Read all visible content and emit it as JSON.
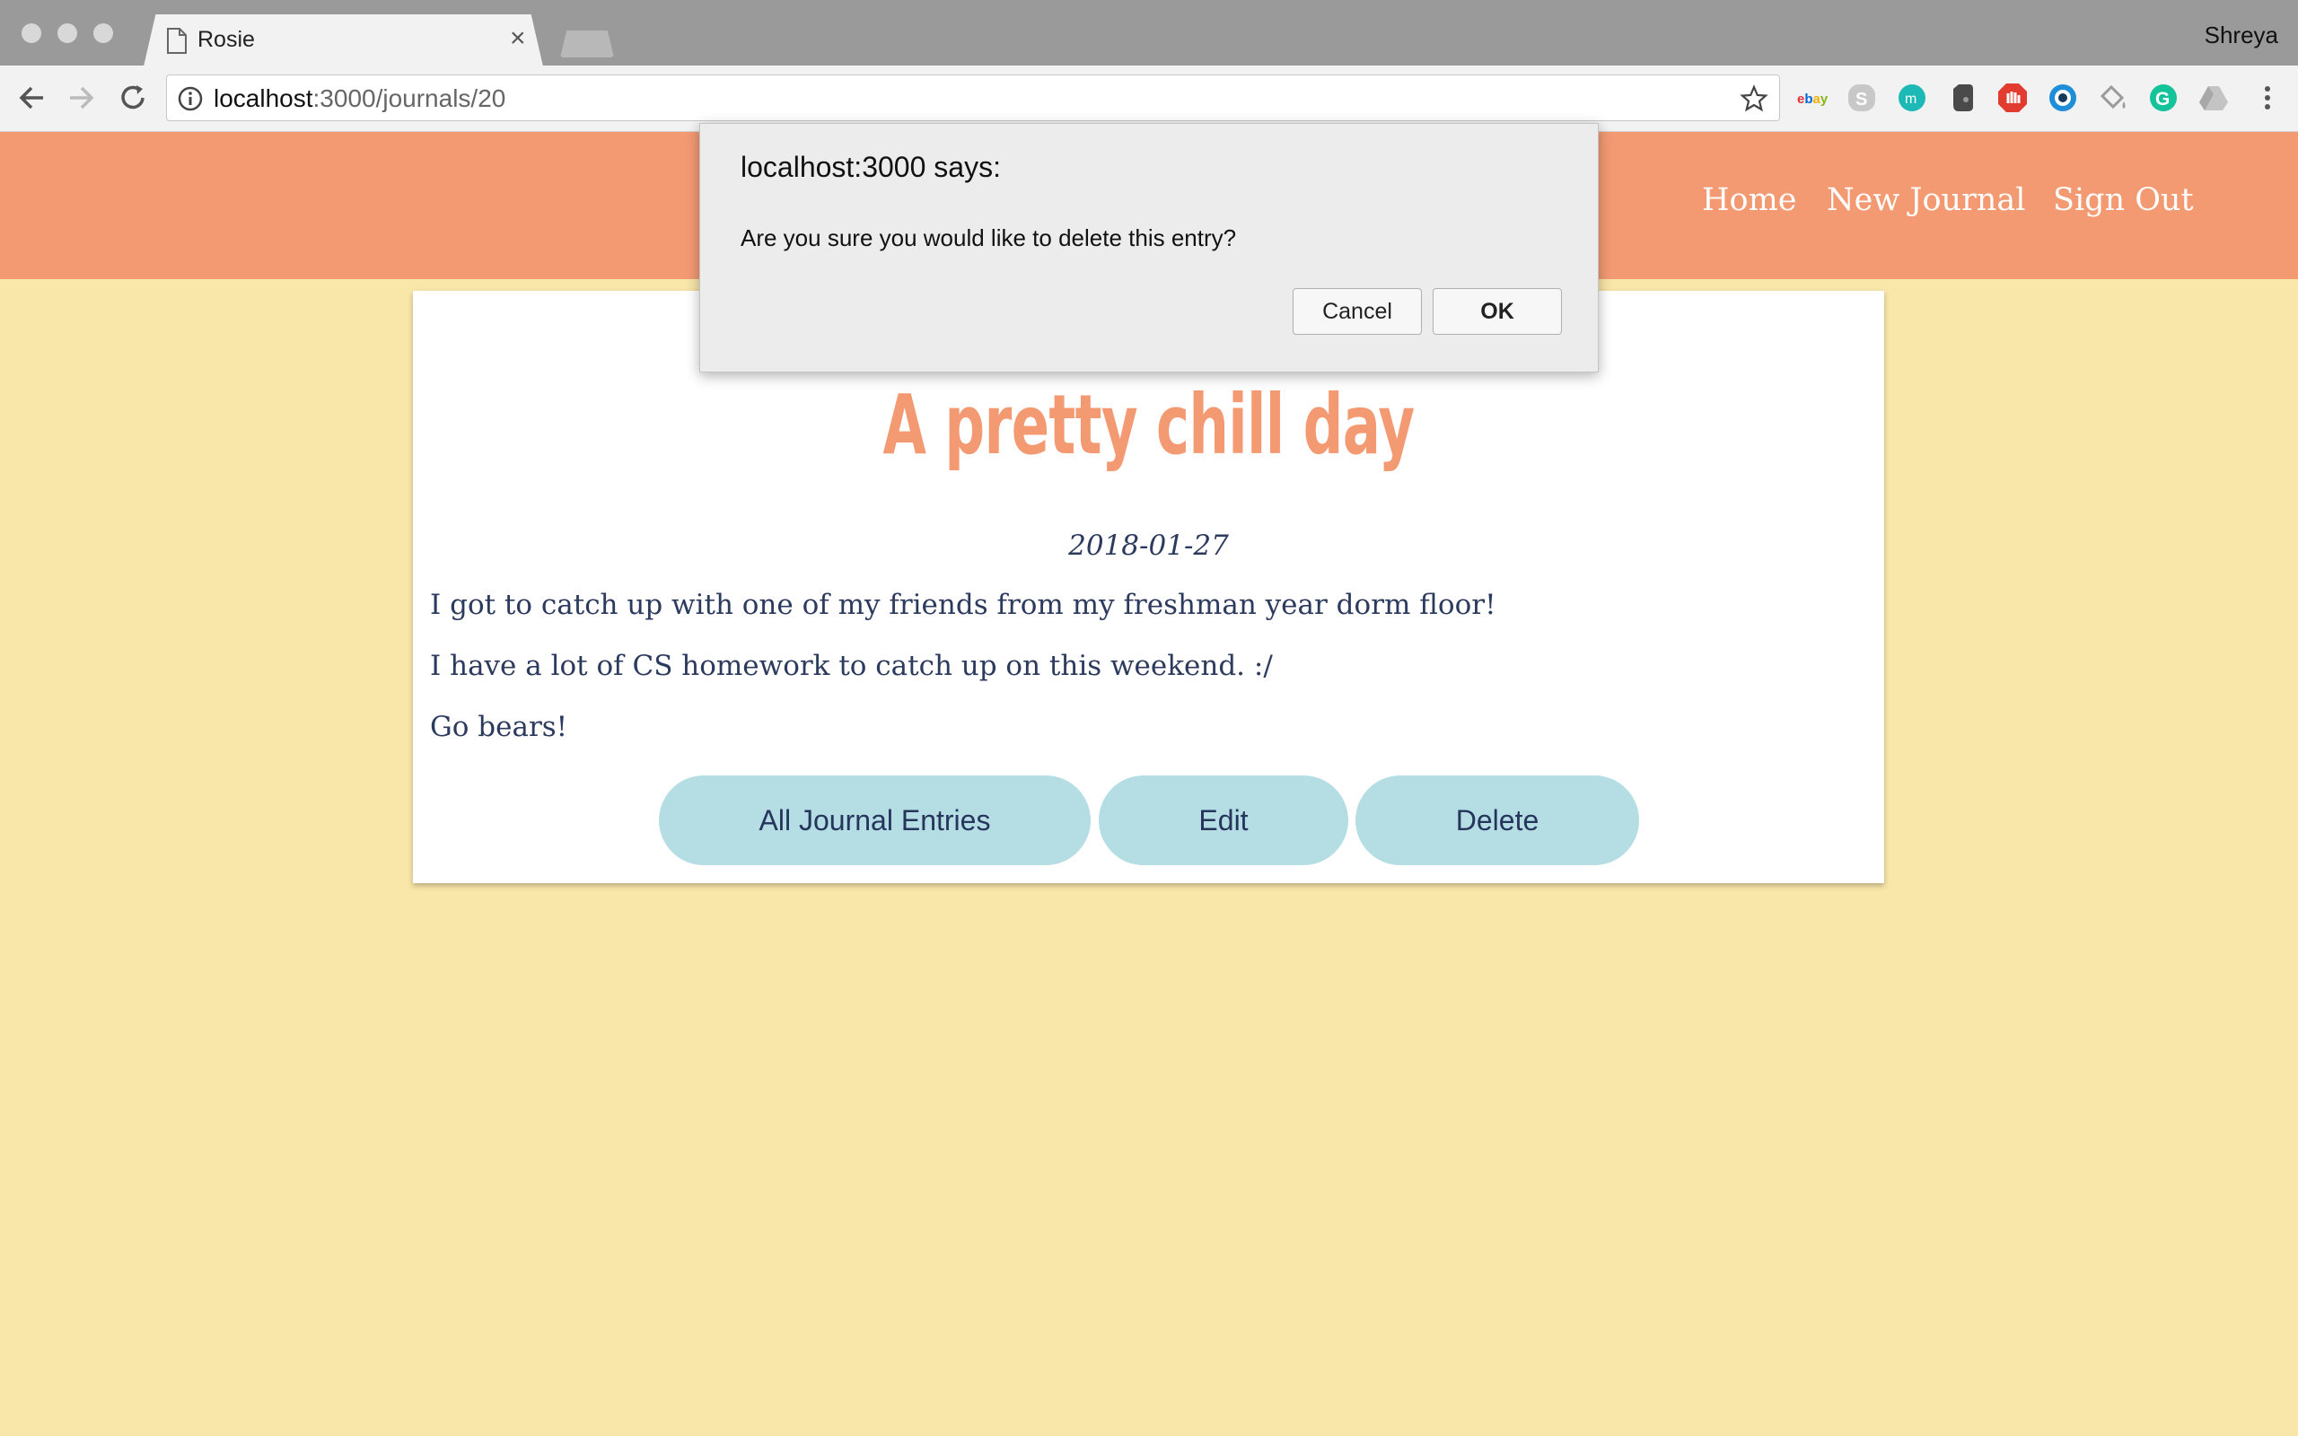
{
  "browser": {
    "tab_title": "Rosie",
    "tab_close": "×",
    "profile_name": "Shreya",
    "url_host": "localhost",
    "url_path": ":3000/journals/20",
    "extension_icons": [
      "ebay-icon",
      "skype-icon",
      "mint-icon",
      "evernote-icon",
      "adblock-icon",
      "camera-icon",
      "paint-bucket-icon",
      "grammarly-icon",
      "drive-icon"
    ]
  },
  "header": {
    "nav": [
      "Home",
      "New Journal",
      "Sign Out"
    ],
    "color": "#f39a73"
  },
  "entry": {
    "title": "A pretty chill day",
    "date": "2018-01-27",
    "lines": [
      "I got to catch up with one of my friends from my freshman year dorm floor!",
      "I have a lot of CS homework to catch up on this weekend. :/",
      "Go bears!"
    ],
    "buttons": {
      "all": "All Journal Entries",
      "edit": "Edit",
      "delete": "Delete"
    }
  },
  "dialog": {
    "title": "localhost:3000 says:",
    "message": "Are you sure you would like to delete this entry?",
    "cancel": "Cancel",
    "ok": "OK"
  },
  "colors": {
    "background": "#f9e6a9",
    "accent": "#f39a73",
    "button": "#b4dde4",
    "text": "#2c3a5e"
  }
}
